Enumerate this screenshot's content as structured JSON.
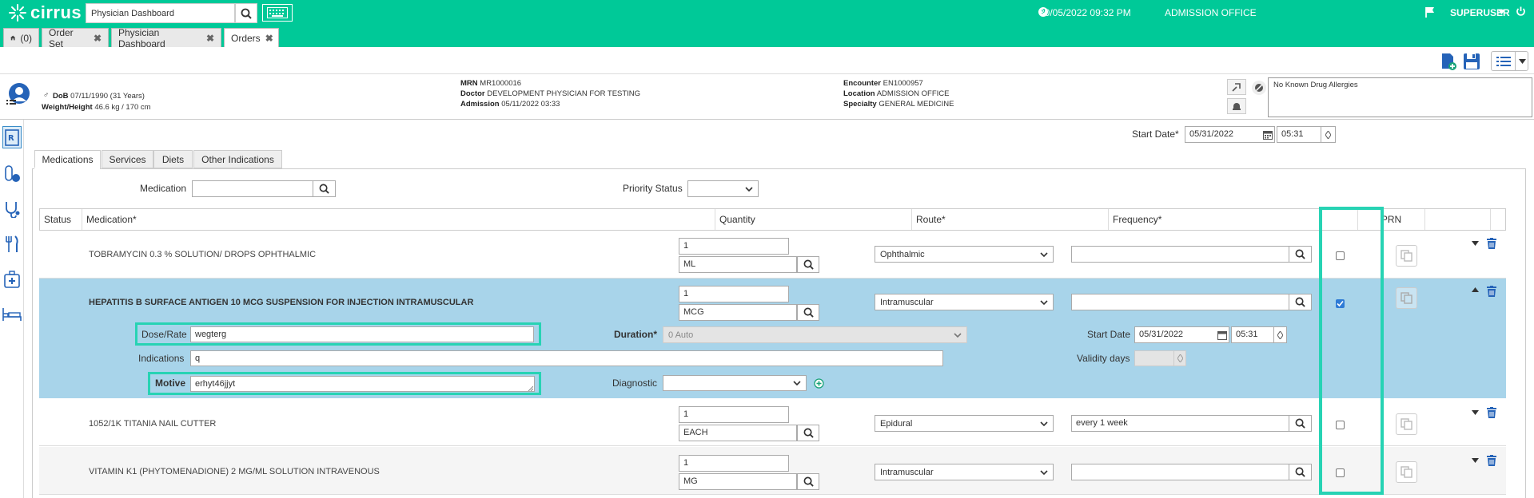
{
  "topbar": {
    "brand": "cirrus",
    "search_value": "Physician Dashboard",
    "datetime": "30/05/2022 09:32 PM",
    "location": "ADMISSION OFFICE",
    "user": "SUPERUSER"
  },
  "tabs": [
    {
      "label": "(0)"
    },
    {
      "label": "Order Set"
    },
    {
      "label": "Physician Dashboard"
    },
    {
      "label": "Orders"
    }
  ],
  "patient": {
    "dob_label": "DoB",
    "dob": "07/11/1990 (31 Years)",
    "wh_label": "Weight/Height",
    "wh": "46.6 kg / 170 cm",
    "mrn_label": "MRN",
    "mrn": "MR1000016",
    "doctor_label": "Doctor",
    "doctor": "DEVELOPMENT PHYSICIAN FOR TESTING",
    "admission_label": "Admission",
    "admission": "05/11/2022 03:33",
    "encounter_label": "Encounter",
    "encounter": "EN1000957",
    "location_label": "Location",
    "location": "ADMISSION OFFICE",
    "specialty_label": "Specialty",
    "specialty": "GENERAL MEDICINE",
    "allergies": "No Known Drug Allergies"
  },
  "form": {
    "start_date_label": "Start Date*",
    "start_date": "05/31/2022",
    "start_time": "05:31",
    "medication_label": "Medication",
    "priority_label": "Priority Status"
  },
  "section_tabs": [
    "Medications",
    "Services",
    "Diets",
    "Other Indications"
  ],
  "grid": {
    "headers": [
      "Status",
      "Medication*",
      "Quantity",
      "Route*",
      "Frequency*",
      "PRN"
    ],
    "rows": [
      {
        "name": "TOBRAMYCIN 0.3 % SOLUTION/ DROPS OPHTHALMIC",
        "qty": "1",
        "unit": "ML",
        "route": "Ophthalmic",
        "frequency": "",
        "prn": false
      },
      {
        "name": "HEPATITIS B SURFACE ANTIGEN 10 MCG SUSPENSION FOR INJECTION INTRAMUSCULAR",
        "qty": "1",
        "unit": "MCG",
        "route": "Intramuscular",
        "frequency": "",
        "prn": true
      },
      {
        "name": "1052/1K TITANIA NAIL CUTTER",
        "qty": "1",
        "unit": "EACH",
        "route": "Epidural",
        "frequency": "every 1 week",
        "prn": false
      },
      {
        "name": "VITAMIN K1 (PHYTOMENADIONE) 2 MG/ML SOLUTION INTRAVENOUS",
        "qty": "1",
        "unit": "MG",
        "route": "Intramuscular",
        "frequency": "",
        "prn": false
      }
    ],
    "detail": {
      "dose_label": "Dose/Rate",
      "dose": "wegterg",
      "duration_label": "Duration*",
      "duration": "0 Auto",
      "start_date_label": "Start Date",
      "start_date": "05/31/2022",
      "start_time": "05:31",
      "indications_label": "Indications",
      "indications": "q",
      "validity_label": "Validity days",
      "motive_label": "Motive",
      "motive": "erhyt46jjyt",
      "diagnostic_label": "Diagnostic"
    }
  },
  "colors": {
    "brand": "#00c998",
    "selected_row": "#a8d4ea",
    "highlight": "#27d3b4",
    "delete": "#2563b8"
  }
}
